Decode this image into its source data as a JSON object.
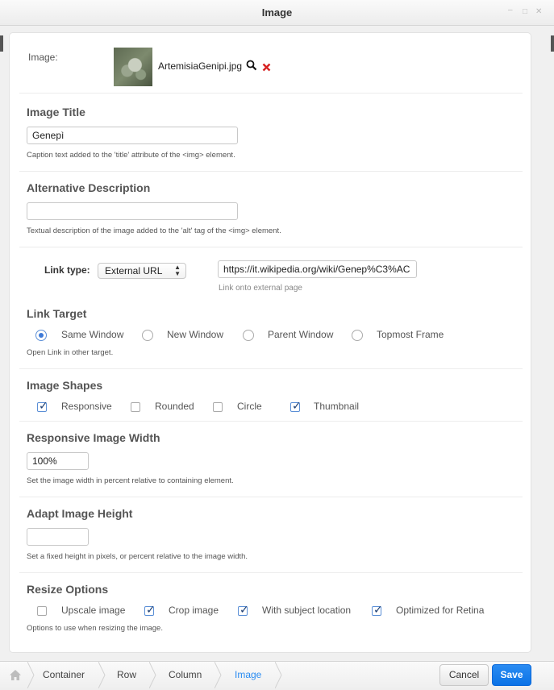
{
  "window": {
    "title": "Image"
  },
  "image": {
    "label": "Image:",
    "filename": "ArtemisiaGenipi.jpg",
    "icons": [
      "magnifier-icon",
      "delete-x-icon"
    ]
  },
  "image_title": {
    "heading": "Image Title",
    "value": "Genepì",
    "help": "Caption text added to the 'title' attribute of the <img> element."
  },
  "alt_description": {
    "heading": "Alternative Description",
    "value": "",
    "help": "Textual description of the image added to the 'alt' tag of the <img> element."
  },
  "link": {
    "type_label": "Link type:",
    "type_value": "External URL",
    "url_value": "https://it.wikipedia.org/wiki/Genep%C3%AC",
    "url_help": "Link onto external page"
  },
  "link_target": {
    "heading": "Link Target",
    "options": [
      "Same Window",
      "New Window",
      "Parent Window",
      "Topmost Frame"
    ],
    "selected": "Same Window",
    "help": "Open Link in other target."
  },
  "image_shapes": {
    "heading": "Image Shapes",
    "options": [
      {
        "label": "Responsive",
        "checked": true
      },
      {
        "label": "Rounded",
        "checked": false
      },
      {
        "label": "Circle",
        "checked": false
      },
      {
        "label": "Thumbnail",
        "checked": true
      }
    ]
  },
  "responsive_width": {
    "heading": "Responsive Image Width",
    "value": "100%",
    "help": "Set the image width in percent relative to containing element."
  },
  "adapt_height": {
    "heading": "Adapt Image Height",
    "value": "",
    "help": "Set a fixed height in pixels, or percent relative to the image width."
  },
  "resize_options": {
    "heading": "Resize Options",
    "options": [
      {
        "label": "Upscale image",
        "checked": false
      },
      {
        "label": "Crop image",
        "checked": true
      },
      {
        "label": "With subject location",
        "checked": true
      },
      {
        "label": "Optimized for Retina",
        "checked": true
      }
    ],
    "help": "Options to use when resizing the image."
  },
  "footer": {
    "breadcrumb": [
      "Container",
      "Row",
      "Column",
      "Image"
    ],
    "cancel_label": "Cancel",
    "save_label": "Save"
  },
  "colors": {
    "accent": "#0b72e6",
    "active_crumb": "#2a8cf2",
    "delete": "#d62020"
  }
}
